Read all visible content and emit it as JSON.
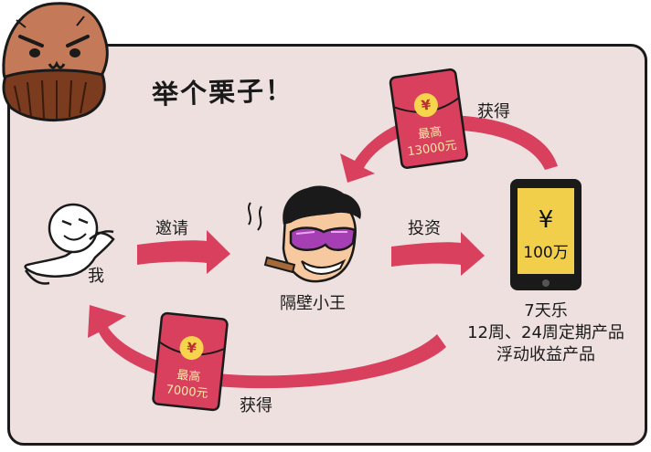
{
  "title": "举个栗子！",
  "people": {
    "me": "我",
    "friend": "隔壁小王"
  },
  "flow": {
    "invite": "邀请",
    "invest": "投资",
    "gain_top": "获得",
    "gain_bottom": "获得"
  },
  "phone": {
    "symbol": "¥",
    "amount": "100万"
  },
  "products": {
    "line1": "7天乐",
    "line2": "12周、24周定期产品",
    "line3": "浮动收益产品"
  },
  "red_packets": {
    "top": {
      "symbol": "¥",
      "label": "最高",
      "amount": "13000元"
    },
    "bottom": {
      "symbol": "¥",
      "label": "最高",
      "amount": "7000元"
    }
  },
  "colors": {
    "panel": "#ede0df",
    "arrow": "#d8405e",
    "packet": "#d8405e",
    "coin": "#f6d44c",
    "phone_screen": "#f2cf4a"
  }
}
